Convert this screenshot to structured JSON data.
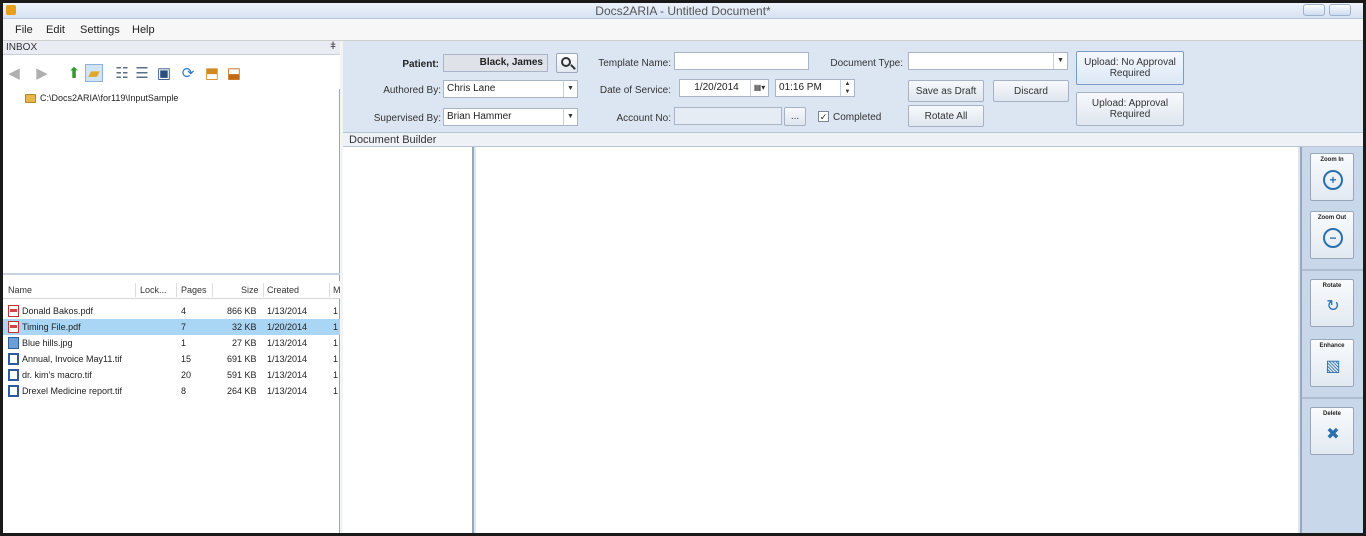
{
  "window": {
    "title": "Docs2ARIA - Untitled Document*"
  },
  "menu": [
    "File",
    "Edit",
    "Settings",
    "Help"
  ],
  "inbox": {
    "title": "INBOX",
    "pin": "ᵖ",
    "folder_path": "C:\\Docs2ARIA\\for119\\InputSample",
    "columns": [
      "Name",
      "Lock...",
      "Pages",
      "Size",
      "Created",
      "M"
    ],
    "files": [
      {
        "name": "Donald Bakos.pdf",
        "pages": "4",
        "size": "866 KB",
        "created": "1/13/2014",
        "more": "1",
        "type": "pdf",
        "selected": false
      },
      {
        "name": "Timing File.pdf",
        "pages": "7",
        "size": "32 KB",
        "created": "1/20/2014",
        "more": "1",
        "type": "pdf",
        "selected": true
      },
      {
        "name": "Blue hills.jpg",
        "pages": "1",
        "size": "27 KB",
        "created": "1/13/2014",
        "more": "1",
        "type": "jpg",
        "selected": false
      },
      {
        "name": "Annual, Invoice May11.tif",
        "pages": "15",
        "size": "691 KB",
        "created": "1/13/2014",
        "more": "1",
        "type": "tif",
        "selected": false
      },
      {
        "name": "dr. kim's macro.tif",
        "pages": "20",
        "size": "591 KB",
        "created": "1/13/2014",
        "more": "1",
        "type": "tif",
        "selected": false
      },
      {
        "name": "Drexel Medicine report.tif",
        "pages": "8",
        "size": "264 KB",
        "created": "1/13/2014",
        "more": "1",
        "type": "tif",
        "selected": false
      }
    ]
  },
  "form": {
    "patient_label": "Patient:",
    "patient_value": "Black, James",
    "authored_label": "Authored By:",
    "authored_value": "Chris Lane",
    "supervised_label": "Supervised By:",
    "supervised_value": "Brian Hammer",
    "template_label": "Template Name:",
    "template_value": "",
    "dos_label": "Date of Service:",
    "dos_date": "1/20/2014",
    "dos_time": "01:16 PM",
    "account_label": "Account No:",
    "account_value": "",
    "account_btn": "...",
    "completed_label": "Completed",
    "completed_checked": "✓",
    "doctype_label": "Document Type:",
    "doctype_value": ""
  },
  "buttons": {
    "save_draft": "Save as Draft",
    "discard": "Discard",
    "rotate_all": "Rotate All",
    "upload_no_approval": "Upload: No Approval Required",
    "upload_approval": "Upload: Approval Required"
  },
  "document_builder": {
    "title": "Document Builder"
  },
  "side_tools": {
    "zoom_in": "Zoom In",
    "zoom_out": "Zoom Out",
    "rotate": "Rotate",
    "enhance": "Enhance",
    "delete": "Delete"
  },
  "colors": {
    "selected_row": "#a9d6f5",
    "panel": "#dce6f2",
    "side_tools": "#c8d8ea"
  }
}
